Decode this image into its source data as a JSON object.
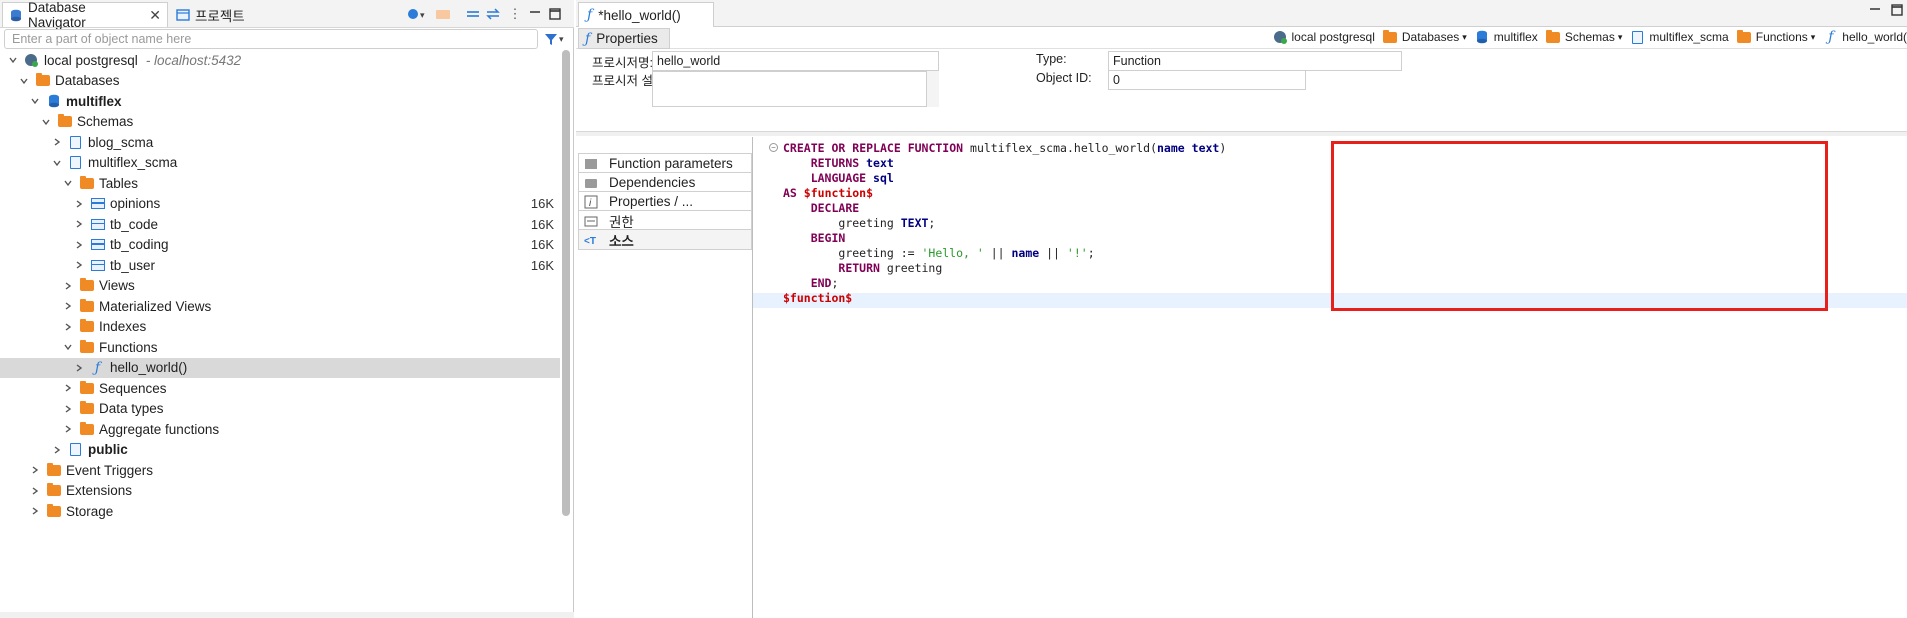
{
  "navigator": {
    "tabs": [
      {
        "label": "Database Navigator",
        "icon": "database-navigator-icon"
      },
      {
        "label": "프로젝트",
        "icon": "project-icon"
      }
    ],
    "filter_placeholder": "Enter a part of object name here",
    "tree": [
      {
        "label": "local postgresql",
        "suffix": "- localhost:5432",
        "level": 0,
        "expanded": true,
        "icon": "postgres-connection-icon"
      },
      {
        "label": "Databases",
        "level": 1,
        "expanded": true,
        "icon": "databases-folder-icon"
      },
      {
        "label": "multiflex",
        "level": 2,
        "expanded": true,
        "bold": true,
        "icon": "database-icon"
      },
      {
        "label": "Schemas",
        "level": 3,
        "expanded": true,
        "icon": "schemas-folder-icon"
      },
      {
        "label": "blog_scma",
        "level": 4,
        "expanded": false,
        "icon": "schema-icon"
      },
      {
        "label": "multiflex_scma",
        "level": 4,
        "expanded": true,
        "icon": "schema-icon"
      },
      {
        "label": "Tables",
        "level": 5,
        "expanded": true,
        "icon": "tables-folder-icon"
      },
      {
        "label": "opinions",
        "level": 6,
        "expanded": false,
        "icon": "table-icon",
        "size": "16K"
      },
      {
        "label": "tb_code",
        "level": 6,
        "expanded": false,
        "icon": "table-icon",
        "size": "16K"
      },
      {
        "label": "tb_coding",
        "level": 6,
        "expanded": false,
        "icon": "table-icon",
        "size": "16K"
      },
      {
        "label": "tb_user",
        "level": 6,
        "expanded": false,
        "icon": "table-icon",
        "size": "16K"
      },
      {
        "label": "Views",
        "level": 5,
        "expanded": false,
        "icon": "views-folder-icon"
      },
      {
        "label": "Materialized Views",
        "level": 5,
        "expanded": false,
        "icon": "views-folder-icon"
      },
      {
        "label": "Indexes",
        "level": 5,
        "expanded": false,
        "icon": "folder-icon"
      },
      {
        "label": "Functions",
        "level": 5,
        "expanded": true,
        "icon": "folder-icon"
      },
      {
        "label": "hello_world()",
        "level": 6,
        "expanded": false,
        "icon": "function-icon",
        "selected": true
      },
      {
        "label": "Sequences",
        "level": 5,
        "expanded": false,
        "icon": "folder-icon"
      },
      {
        "label": "Data types",
        "level": 5,
        "expanded": false,
        "icon": "folder-icon"
      },
      {
        "label": "Aggregate functions",
        "level": 5,
        "expanded": false,
        "icon": "folder-icon"
      },
      {
        "label": "public",
        "level": 4,
        "expanded": false,
        "bold": true,
        "icon": "schema-icon"
      },
      {
        "label": "Event Triggers",
        "level": 2,
        "expanded": false,
        "icon": "folder-icon"
      },
      {
        "label": "Extensions",
        "level": 2,
        "expanded": false,
        "icon": "extensions-folder-icon"
      },
      {
        "label": "Storage",
        "level": 2,
        "expanded": false,
        "icon": "folder-icon"
      }
    ]
  },
  "editor": {
    "tab_label": "*hello_world()",
    "properties_tab": "Properties",
    "breadcrumbs": [
      {
        "label": "local postgresql",
        "icon": "postgres-connection-icon",
        "dropdown": false
      },
      {
        "label": "Databases",
        "icon": "databases-folder-icon",
        "dropdown": true
      },
      {
        "label": "multiflex",
        "icon": "database-icon",
        "dropdown": false
      },
      {
        "label": "Schemas",
        "icon": "schemas-folder-icon",
        "dropdown": true
      },
      {
        "label": "multiflex_scma",
        "icon": "schema-icon",
        "dropdown": false
      },
      {
        "label": "Functions",
        "icon": "folder-icon",
        "dropdown": true
      },
      {
        "label": "hello_world(",
        "icon": "function-icon",
        "dropdown": false
      }
    ],
    "form": {
      "name_label": "프로시저명:",
      "name_value": "hello_world",
      "desc_label": "프로시저 설명:",
      "desc_value": "",
      "type_label": "Type:",
      "type_value": "Function",
      "oid_label": "Object ID:",
      "oid_value": "0"
    },
    "side_tabs": [
      {
        "label": "Function parameters",
        "icon": "parameters-icon"
      },
      {
        "label": "Dependencies",
        "icon": "dependencies-icon"
      },
      {
        "label": "Properties / ...",
        "icon": "info-icon"
      },
      {
        "label": "권한",
        "icon": "permissions-icon"
      },
      {
        "label": "소스",
        "icon": "source-icon",
        "active": true
      }
    ],
    "code_lines": [
      "CREATE OR REPLACE FUNCTION multiflex_scma.hello_world(name text)",
      "    RETURNS text",
      "    LANGUAGE sql",
      "AS $function$",
      "    DECLARE",
      "        greeting TEXT;",
      "    BEGIN",
      "        greeting := 'Hello, ' || name || '!';",
      "        RETURN greeting",
      "    END;",
      "$function$"
    ],
    "highlight_color": "#e8201c"
  }
}
